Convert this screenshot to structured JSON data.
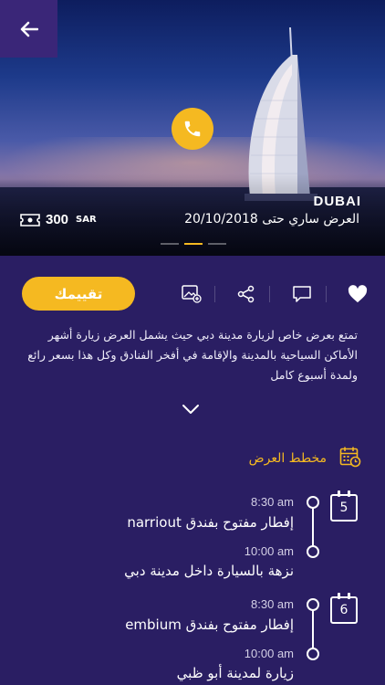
{
  "hero": {
    "city": "DUBAI",
    "valid_text": "العرض ساري حتى 20/10/2018",
    "price_amount": "300",
    "price_currency": "SAR",
    "slides_count": 3,
    "active_slide": 2
  },
  "actions": {
    "rate_label": "تقييمك"
  },
  "description": "تمتع بعرض خاص لزيارة مدينة دبي حيث يشمل العرض زيارة أشهر الأماكن السياحية بالمدينة والإقامة في أفخر الفنادق وكل هذا بسعر رائع ولمدة أسبوع كامل",
  "plan": {
    "title": "مخطط العرض",
    "days": [
      {
        "day": "5",
        "events": [
          {
            "time": "8:30 am",
            "title": "إفطار مفتوح بفندق narriout"
          },
          {
            "time": "10:00 am",
            "title": "نزهة بالسيارة داخل مدينة دبي"
          }
        ]
      },
      {
        "day": "6",
        "events": [
          {
            "time": "8:30 am",
            "title": "إفطار مفتوح بفندق embium"
          },
          {
            "time": "10:00 am",
            "title": "زيارة لمدينة أبو ظبي"
          }
        ]
      }
    ]
  },
  "colors": {
    "accent": "#f5b921",
    "background": "#2a1e63",
    "back_button": "#3a2678"
  }
}
